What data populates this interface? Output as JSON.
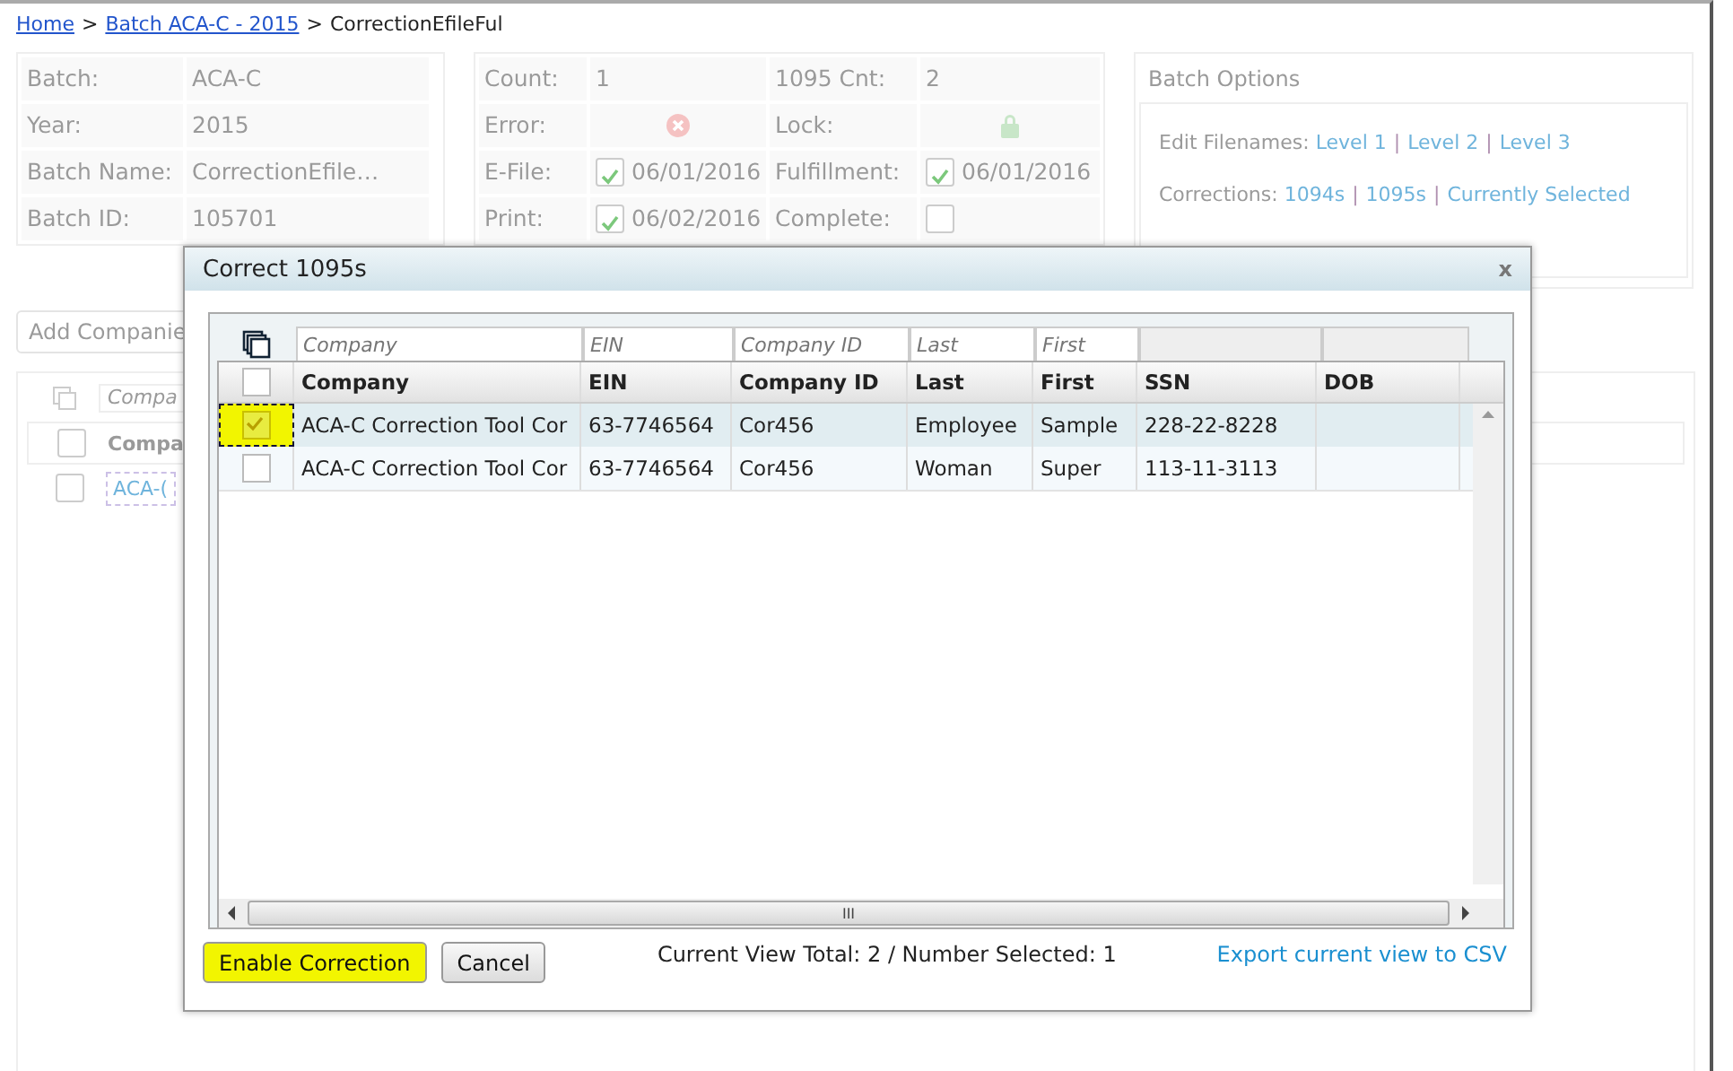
{
  "breadcrumb": [
    {
      "label": "Home",
      "kind": "link"
    },
    {
      "label": ">",
      "kind": "separator"
    },
    {
      "label": "Batch ACA-C - 2015",
      "kind": "link"
    },
    {
      "label": ">",
      "kind": "separator"
    },
    {
      "label": "CorrectionEfileFul",
      "kind": "current"
    }
  ],
  "batch_info": [
    {
      "label": "Batch:",
      "value": "ACA-C"
    },
    {
      "label": "Year:",
      "value": "2015"
    },
    {
      "label": "Batch Name:",
      "value": "CorrectionEfile…"
    },
    {
      "label": "Batch ID:",
      "value": "105701"
    }
  ],
  "batch_status": [
    {
      "kind": "text",
      "label": "Count:",
      "value": "1"
    },
    {
      "kind": "text",
      "label": "1095 Cnt:",
      "value": "2"
    },
    {
      "kind": "error",
      "label": "Error:"
    },
    {
      "kind": "lock",
      "label": "Lock:"
    },
    {
      "kind": "check",
      "label": "E-File:",
      "checked": true,
      "value": "06/01/2016"
    },
    {
      "kind": "check",
      "label": "Fulfillment:",
      "checked": true,
      "value": "06/01/2016"
    },
    {
      "kind": "check",
      "label": "Print:",
      "checked": true,
      "value": "06/02/2016"
    },
    {
      "kind": "check",
      "label": "Complete:",
      "checked": false
    }
  ],
  "batch_options": {
    "title": "Batch Options",
    "separator": "|",
    "lines": [
      {
        "label": "Edit Filenames:",
        "links": [
          "Level 1",
          "Level 2",
          "Level 3"
        ]
      },
      {
        "label": "Corrections:",
        "links": [
          "1094s",
          "1095s",
          "Currently Selected"
        ]
      }
    ]
  },
  "add_button": "Add Companie",
  "companies_grid": {
    "filter_placeholder": "Compa",
    "column": "Compa",
    "select_all_checked": false,
    "rows": [
      {
        "checked": false,
        "link": "ACA-("
      }
    ]
  },
  "modal": {
    "title": "Correct 1095s",
    "close": "x",
    "filters": [
      {
        "placeholder": "Company"
      },
      {
        "placeholder": "EIN"
      },
      {
        "placeholder": "Company ID"
      },
      {
        "placeholder": "Last"
      },
      {
        "placeholder": "First"
      }
    ],
    "select_all_checked": false,
    "columns": [
      "Company",
      "EIN",
      "Company ID",
      "Last",
      "First",
      "SSN",
      "DOB"
    ],
    "rows": [
      {
        "selected": true,
        "cells": [
          "ACA-C Correction Tool Cor",
          "63-7746564",
          "Cor456",
          "Employee",
          "Sample",
          "228-22-8228",
          ""
        ]
      },
      {
        "selected": false,
        "cells": [
          "ACA-C Correction Tool Cor",
          "63-7746564",
          "Cor456",
          "Woman",
          "Super",
          "113-11-3113",
          ""
        ]
      }
    ],
    "scroll_grip": "III",
    "buttons": [
      {
        "label": "Enable Correction",
        "highlighted": true
      },
      {
        "label": "Cancel",
        "highlighted": false
      }
    ],
    "summary": "Current View Total: 2 / Number Selected: 1",
    "export_link": "Export current view to CSV"
  }
}
